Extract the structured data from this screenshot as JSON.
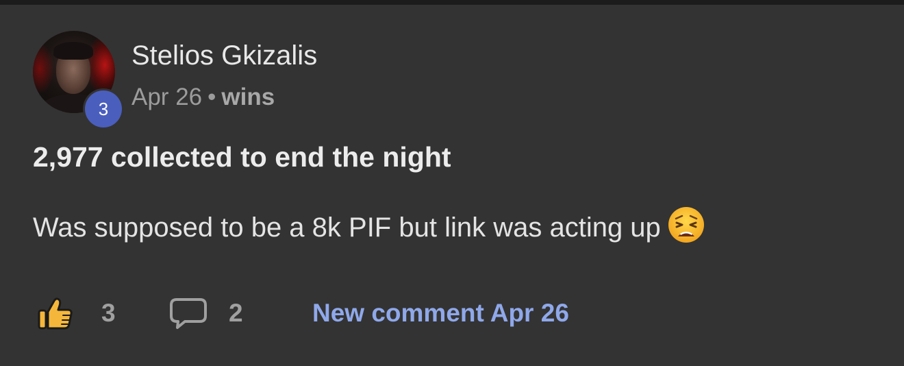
{
  "post": {
    "author": {
      "name": "Stelios Gkizalis",
      "level": "3",
      "level_badge_color": "#4a5ebd"
    },
    "meta": {
      "date": "Apr 26",
      "separator": "•",
      "category": "wins"
    },
    "title": "2,977 collected to end the night",
    "body": "Was supposed to be a 8k PIF but link was acting up",
    "body_emoji": "weary-face-emoji",
    "actions": {
      "like_icon": "thumbs-up-icon",
      "like_count": "3",
      "comment_icon": "speech-bubble-icon",
      "comment_count": "2",
      "new_comment_label": "New comment Apr 26",
      "accent_color": "#8fa8ea"
    }
  }
}
